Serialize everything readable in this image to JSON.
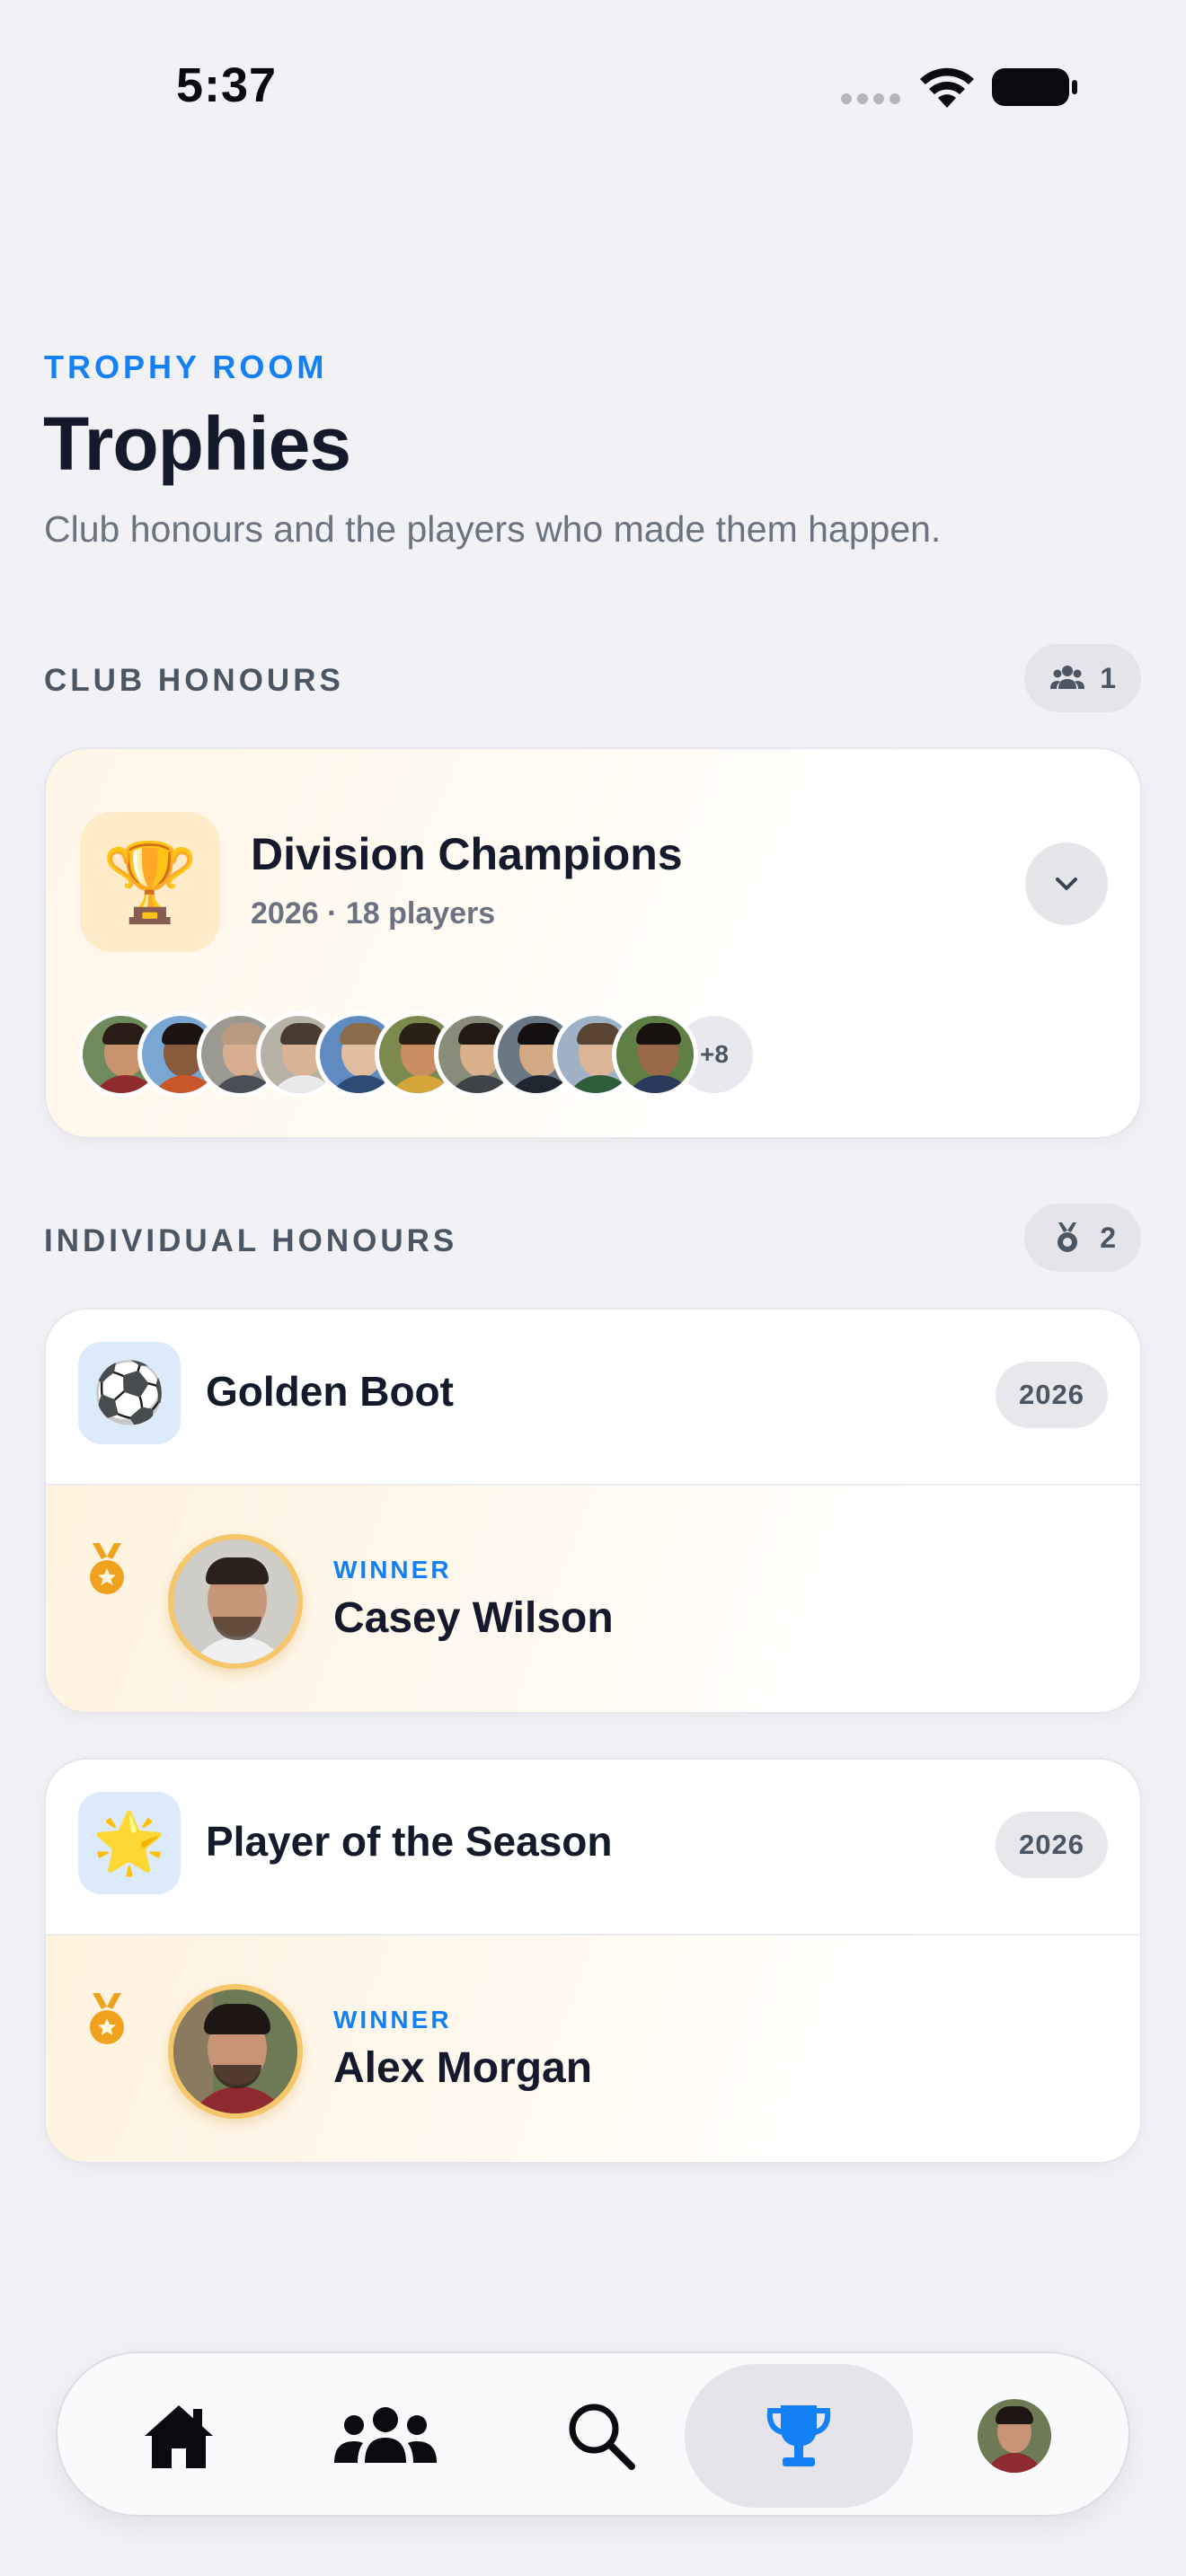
{
  "status_bar": {
    "time": "5:37"
  },
  "header": {
    "eyebrow": "TROPHY ROOM",
    "title": "Trophies",
    "subtitle": "Club honours and the players who made them happen."
  },
  "club_honours": {
    "label": "CLUB HONOURS",
    "count": "1",
    "count_icon": "people-icon",
    "card": {
      "icon": "🏆",
      "title": "Division Champions",
      "meta": "2026 · 18 players",
      "more_count": "+8"
    }
  },
  "individual_honours": {
    "label": "INDIVIDUAL HONOURS",
    "count": "2",
    "count_icon": "medal-icon",
    "items": [
      {
        "icon": "⚽",
        "title": "Golden Boot",
        "year": "2026",
        "winner_label": "WINNER",
        "winner_name": "Casey Wilson"
      },
      {
        "icon": "🌟",
        "title": "Player of the Season",
        "year": "2026",
        "winner_label": "WINNER",
        "winner_name": "Alex Morgan"
      }
    ]
  },
  "tab_bar": {
    "tabs": [
      {
        "name": "home",
        "icon": "home-icon"
      },
      {
        "name": "team",
        "icon": "people-icon"
      },
      {
        "name": "search",
        "icon": "search-icon"
      },
      {
        "name": "trophies",
        "icon": "trophy-icon",
        "active": true
      },
      {
        "name": "profile",
        "icon": "avatar"
      }
    ]
  },
  "colors": {
    "accent": "#1381f5",
    "background": "#f2f2f6",
    "medal": "#f0a21e",
    "gold_border": "#f5c76a"
  }
}
